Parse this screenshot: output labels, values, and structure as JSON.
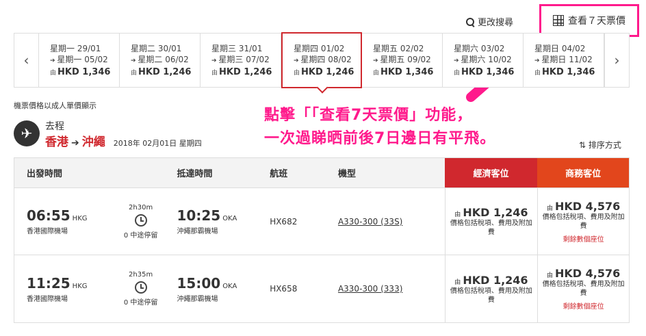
{
  "header": {
    "change_search": "更改搜尋",
    "view_7_days": "查看７天票價"
  },
  "date_strip": [
    {
      "out": "星期一 29/01",
      "ret": "星期一 05/02",
      "currency": "由",
      "price": "HKD 1,346",
      "selected": false
    },
    {
      "out": "星期二 30/01",
      "ret": "星期二 06/02",
      "currency": "由",
      "price": "HKD 1,246",
      "selected": false
    },
    {
      "out": "星期三 31/01",
      "ret": "星期三 07/02",
      "currency": "由",
      "price": "HKD 1,246",
      "selected": false
    },
    {
      "out": "星期四 01/02",
      "ret": "星期四 08/02",
      "currency": "由",
      "price": "HKD 1,246",
      "selected": true
    },
    {
      "out": "星期五 02/02",
      "ret": "星期五 09/02",
      "currency": "由",
      "price": "HKD 1,346",
      "selected": false
    },
    {
      "out": "星期六 03/02",
      "ret": "星期六 10/02",
      "currency": "由",
      "price": "HKD 1,346",
      "selected": false
    },
    {
      "out": "星期日 04/02",
      "ret": "星期日 11/02",
      "currency": "由",
      "price": "HKD 1,346",
      "selected": false
    }
  ],
  "note": "機票價格以成人單價顯示",
  "route": {
    "trip_type": "去程",
    "origin": "香港",
    "destination": "沖繩",
    "date": "2018年 02月01日 星期四"
  },
  "sort_label": "排序方式",
  "annotation": {
    "line1": "點擊「「查看7天票價」功能，",
    "line2": "一次過睇晒前後7日邊日有平飛。"
  },
  "table": {
    "headers": {
      "depart": "出發時間",
      "arrive": "抵達時間",
      "flight": "航班",
      "aircraft": "機型",
      "economy": "經濟客位",
      "business": "商務客位"
    },
    "rows": [
      {
        "dep_time": "06:55",
        "dep_code": "HKG",
        "dep_airport": "香港國際機場",
        "duration": "2h30m",
        "stops": "0 中途停留",
        "arr_time": "10:25",
        "arr_code": "OKA",
        "arr_airport": "沖繩那霸機場",
        "flight": "HX682",
        "aircraft": "A330-300 (33S)",
        "eco_from": "由",
        "eco_price": "HKD 1,246",
        "eco_tax": "價格包括稅項、費用及附加費",
        "biz_from": "由",
        "biz_price": "HKD 4,576",
        "biz_tax": "價格包括稅項、費用及附加費",
        "biz_seats": "剩餘數個座位"
      },
      {
        "dep_time": "11:25",
        "dep_code": "HKG",
        "dep_airport": "香港國際機場",
        "duration": "2h35m",
        "stops": "0 中途停留",
        "arr_time": "15:00",
        "arr_code": "OKA",
        "arr_airport": "沖繩那霸機場",
        "flight": "HX658",
        "aircraft": "A330-300 (333)",
        "eco_from": "由",
        "eco_price": "HKD 1,246",
        "eco_tax": "價格包括稅項、費用及附加費",
        "biz_from": "由",
        "biz_price": "HKD 4,576",
        "biz_tax": "價格包括稅項、費用及附加費",
        "biz_seats": "剩餘數個座位"
      }
    ]
  },
  "colors": {
    "accent": "#d0282e",
    "business": "#e2461c",
    "highlight": "#ff1a8c"
  }
}
